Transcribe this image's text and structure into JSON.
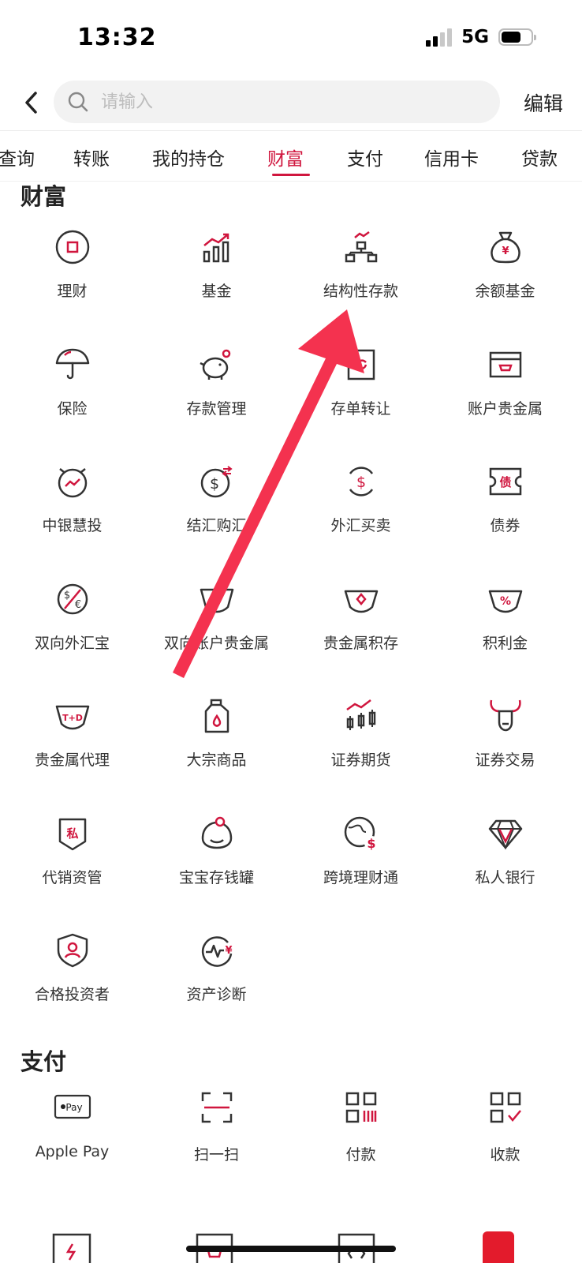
{
  "status": {
    "time": "13:32",
    "network": "5G"
  },
  "search": {
    "placeholder": "请输入"
  },
  "header": {
    "edit_label": "编辑"
  },
  "tabs": [
    {
      "label": "查询"
    },
    {
      "label": "转账"
    },
    {
      "label": "我的持仓"
    },
    {
      "label": "财富",
      "active": true
    },
    {
      "label": "支付"
    },
    {
      "label": "信用卡"
    },
    {
      "label": "贷款"
    }
  ],
  "wealth": {
    "title": "财富",
    "items": [
      {
        "label": "理财",
        "icon": "wealth-management-icon"
      },
      {
        "label": "基金",
        "icon": "fund-chart-icon"
      },
      {
        "label": "结构性存款",
        "icon": "structured-deposit-icon"
      },
      {
        "label": "余额基金",
        "icon": "money-bag-icon"
      },
      {
        "label": "保险",
        "icon": "umbrella-icon"
      },
      {
        "label": "存款管理",
        "icon": "piggy-bank-icon"
      },
      {
        "label": "存单转让",
        "icon": "deposit-transfer-icon"
      },
      {
        "label": "账户贵金属",
        "icon": "account-metal-icon"
      },
      {
        "label": "中银慧投",
        "icon": "smart-invest-icon"
      },
      {
        "label": "结汇购汇",
        "icon": "exchange-dollar-icon"
      },
      {
        "label": "外汇买卖",
        "icon": "forex-trade-icon"
      },
      {
        "label": "债券",
        "icon": "bond-ticket-icon"
      },
      {
        "label": "双向外汇宝",
        "icon": "two-way-forex-icon"
      },
      {
        "label": "双向账户贵金属",
        "icon": "two-way-metal-icon"
      },
      {
        "label": "贵金属积存",
        "icon": "metal-accumulation-icon"
      },
      {
        "label": "积利金",
        "icon": "interest-gold-icon"
      },
      {
        "label": "贵金属代理",
        "icon": "metal-agency-icon"
      },
      {
        "label": "大宗商品",
        "icon": "commodity-icon"
      },
      {
        "label": "证券期货",
        "icon": "securities-futures-icon"
      },
      {
        "label": "证券交易",
        "icon": "bull-icon"
      },
      {
        "label": "代销资管",
        "icon": "private-shield-icon"
      },
      {
        "label": "宝宝存钱罐",
        "icon": "baby-savings-icon"
      },
      {
        "label": "跨境理财通",
        "icon": "globe-dollar-icon"
      },
      {
        "label": "私人银行",
        "icon": "diamond-icon"
      },
      {
        "label": "合格投资者",
        "icon": "investor-shield-icon"
      },
      {
        "label": "资产诊断",
        "icon": "asset-diagnosis-icon"
      }
    ]
  },
  "payment": {
    "title": "支付",
    "items": [
      {
        "label": "Apple Pay",
        "icon": "apple-pay-icon",
        "icon_text": "Pay"
      },
      {
        "label": "扫一扫",
        "icon": "scan-icon"
      },
      {
        "label": "付款",
        "icon": "pay-qr-icon"
      },
      {
        "label": "收款",
        "icon": "receive-qr-icon"
      }
    ]
  },
  "colors": {
    "accent": "#d0163e",
    "arrow": "#f4324f",
    "text": "#333333"
  }
}
